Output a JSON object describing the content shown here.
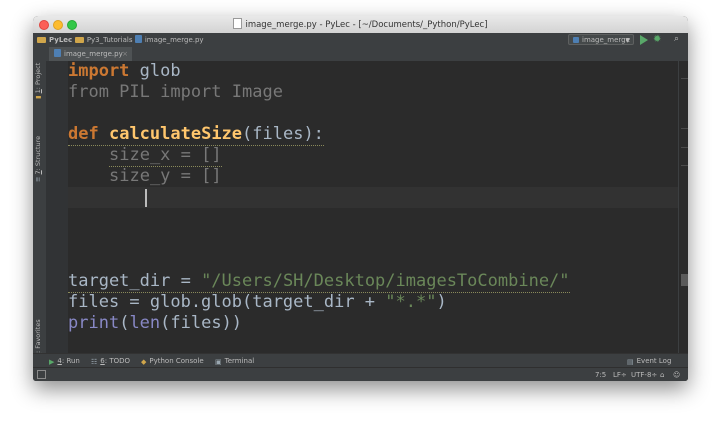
{
  "window": {
    "title": "image_merge.py - PyLec - [~/Documents/_Python/PyLec]"
  },
  "navbar": {
    "breadcrumbs": [
      "PyLec",
      "Py3_Tutorials",
      "image_merge.py"
    ],
    "run_config": "image_merge"
  },
  "left_tools": {
    "project": {
      "num": "1",
      "label": ": Project"
    },
    "structure": {
      "num": "7",
      "label": ": Structure"
    },
    "favorites": {
      "num": "2",
      "label": ": Favorites"
    }
  },
  "editor": {
    "tab_label": "image_merge.py",
    "lines": {
      "l1_kw": "import",
      "l1_rest": " glob",
      "l2": "from PIL import Image",
      "l4_kw": "def",
      "l4_fn": "calculateSize",
      "l4_rest": "(files):",
      "l5": "size_x = []",
      "l6": "size_y = []",
      "l10_a": "target_dir = ",
      "l10_str": "\"/Users/SH/Desktop/imagesToCombine/\"",
      "l11_a": "files = glob.glob(target_dir + ",
      "l11_str": "\"*.*\"",
      "l11_b": ")",
      "l12_a": "print",
      "l12_b": "(",
      "l12_c": "len",
      "l12_d": "(files))"
    }
  },
  "bottom_tools": {
    "run": {
      "num": "4",
      "label": ": Run"
    },
    "todo": {
      "num": "6",
      "label": ": TODO"
    },
    "python_console": "Python Console",
    "terminal": "Terminal",
    "event_log": "Event Log"
  },
  "statusbar": {
    "position": "7:5",
    "line_sep": "LF÷",
    "encoding": "UTF-8÷"
  },
  "colors": {
    "keyword": "#cc7832",
    "function": "#ffc66d",
    "string": "#6a8759",
    "builtin": "#8888c6",
    "text": "#a9b7c6",
    "editor_bg": "#2b2b2b"
  }
}
